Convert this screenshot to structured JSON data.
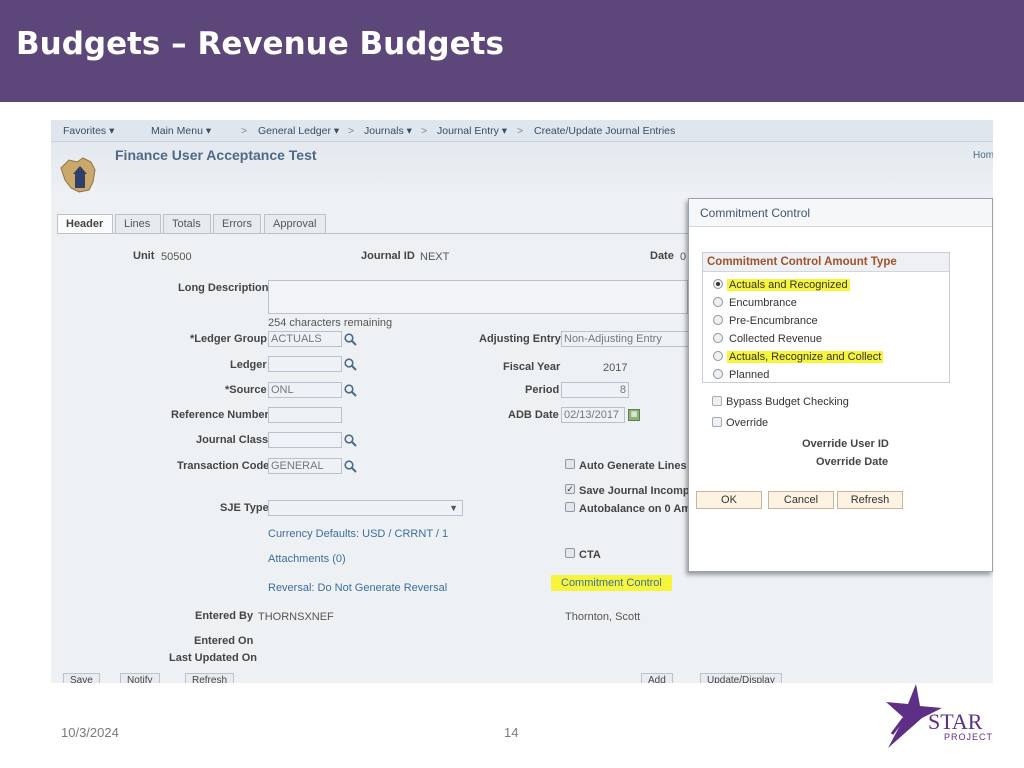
{
  "slide": {
    "title": "Budgets – Revenue Budgets",
    "date": "10/3/2024",
    "page_number": "14",
    "logo_text": "STAR",
    "logo_subtext": "PROJECT"
  },
  "nav": {
    "favorites": "Favorites",
    "main_menu": "Main Menu",
    "breadcrumb": [
      "General Ledger",
      "Journals",
      "Journal Entry",
      "Create/Update Journal Entries"
    ],
    "separator": ">",
    "home": "Hom"
  },
  "app": {
    "title": "Finance User Acceptance Test"
  },
  "tabs": [
    "Header",
    "Lines",
    "Totals",
    "Errors",
    "Approval"
  ],
  "form": {
    "unit_label": "Unit",
    "unit_value": "50500",
    "journal_id_label": "Journal ID",
    "journal_id_value": "NEXT",
    "date_label": "Date",
    "date_value": "0",
    "long_description_label": "Long Description",
    "chars_remaining": "254 characters remaining",
    "ledger_group_label": "*Ledger Group",
    "ledger_group_value": "ACTUALS",
    "adjusting_entry_label": "Adjusting Entry",
    "adjusting_entry_value": "Non-Adjusting Entry",
    "ledger_label": "Ledger",
    "fiscal_year_label": "Fiscal Year",
    "fiscal_year_value": "2017",
    "source_label": "*Source",
    "source_value": "ONL",
    "period_label": "Period",
    "period_value": "8",
    "reference_number_label": "Reference Number",
    "adb_date_label": "ADB Date",
    "adb_date_value": "02/13/2017",
    "journal_class_label": "Journal Class",
    "transaction_code_label": "Transaction Code",
    "transaction_code_value": "GENERAL",
    "auto_generate_lines": "Auto Generate Lines",
    "save_journal_incomplete": "Save Journal Incompl",
    "autobalance": "Autobalance on 0 Am",
    "sje_type_label": "SJE Type",
    "currency_defaults": "Currency Defaults: USD / CRRNT / 1",
    "attachments": "Attachments (0)",
    "cta": "CTA",
    "reversal": "Reversal: Do Not Generate Reversal",
    "commitment_control_link": "Commitment Control",
    "entered_by_label": "Entered By",
    "entered_by_value": "THORNSXNEF",
    "entered_by_name": "Thornton, Scott",
    "entered_on_label": "Entered On",
    "last_updated_label": "Last Updated On"
  },
  "bottom_buttons": [
    "Save",
    "Notify",
    "Refresh",
    "Add",
    "Update/Display"
  ],
  "modal": {
    "title": "Commitment Control",
    "group_title": "Commitment Control Amount Type",
    "options": [
      {
        "label": "Actuals and Recognized",
        "selected": true,
        "highlighted": true
      },
      {
        "label": "Encumbrance",
        "selected": false,
        "highlighted": false
      },
      {
        "label": "Pre-Encumbrance",
        "selected": false,
        "highlighted": false
      },
      {
        "label": "Collected Revenue",
        "selected": false,
        "highlighted": false
      },
      {
        "label": "Actuals, Recognize and Collect",
        "selected": false,
        "highlighted": true
      },
      {
        "label": "Planned",
        "selected": false,
        "highlighted": false
      }
    ],
    "bypass_budget_checking": "Bypass Budget Checking",
    "override": "Override",
    "override_user_id": "Override User ID",
    "override_date": "Override Date",
    "ok": "OK",
    "cancel": "Cancel",
    "refresh": "Refresh"
  },
  "colors": {
    "title_bar": "#5d477a",
    "highlight": "#f7f53b",
    "group_title_text": "#a0522d",
    "link_blue": "#3d6d9e"
  }
}
